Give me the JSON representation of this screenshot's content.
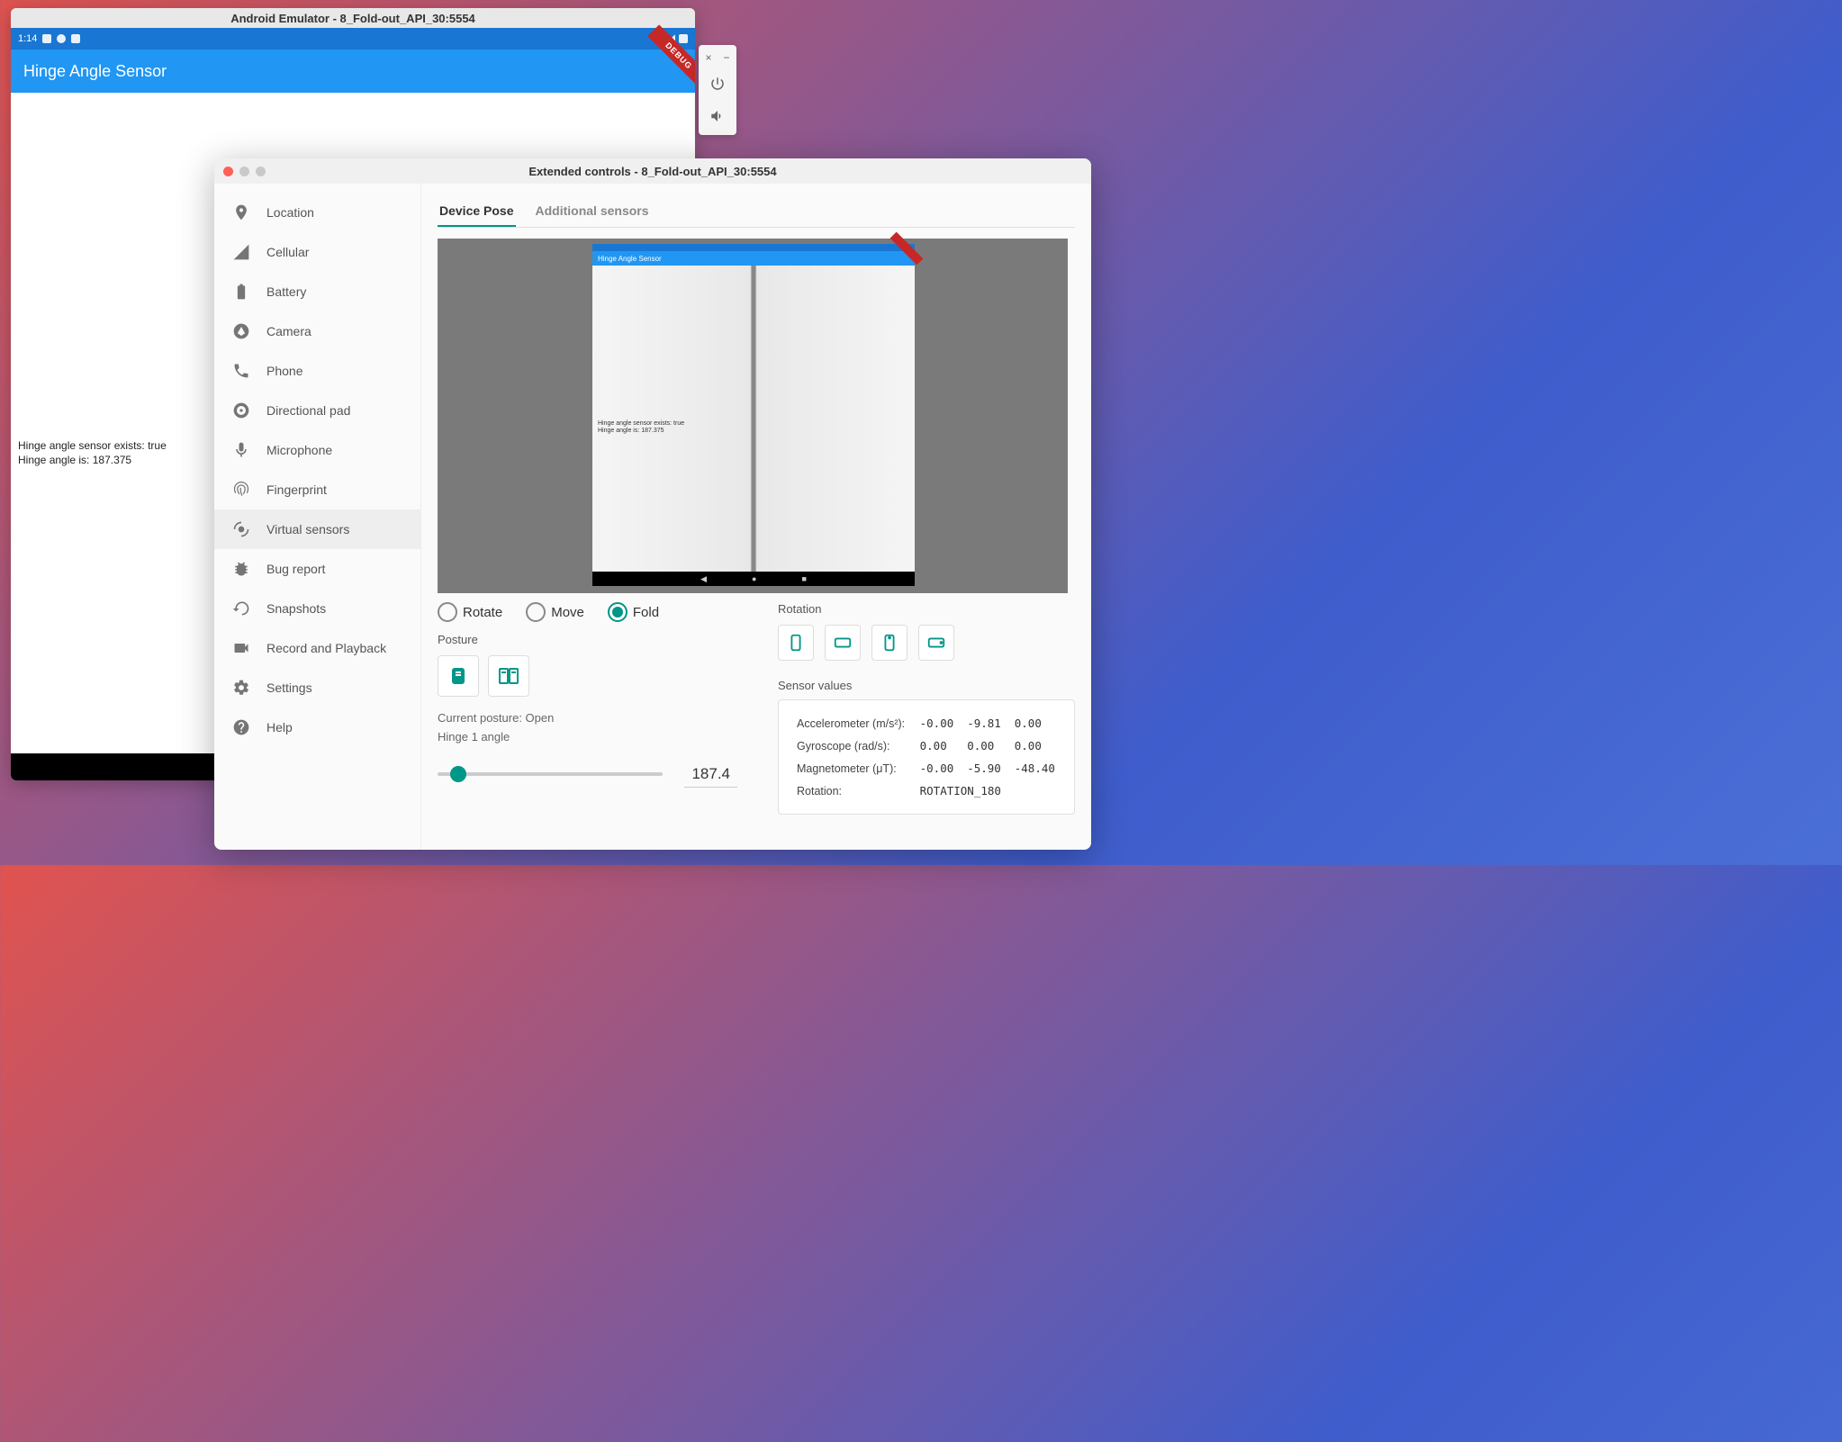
{
  "emulator": {
    "title": "Android Emulator - 8_Fold-out_API_30:5554",
    "statusbar": {
      "time": "1:14"
    },
    "debug_ribbon": "DEBUG",
    "app": {
      "title": "Hinge Angle Sensor",
      "body_line1": "Hinge angle sensor exists: true",
      "body_line2": "Hinge angle is: 187.375"
    }
  },
  "side_toolbar": {
    "close": "×",
    "minimize": "−"
  },
  "extended": {
    "title": "Extended controls - 8_Fold-out_API_30:5554",
    "sidebar": {
      "items": [
        {
          "label": "Location",
          "icon": "location"
        },
        {
          "label": "Cellular",
          "icon": "cellular"
        },
        {
          "label": "Battery",
          "icon": "battery"
        },
        {
          "label": "Camera",
          "icon": "camera"
        },
        {
          "label": "Phone",
          "icon": "phone"
        },
        {
          "label": "Directional pad",
          "icon": "dpad"
        },
        {
          "label": "Microphone",
          "icon": "mic"
        },
        {
          "label": "Fingerprint",
          "icon": "fingerprint"
        },
        {
          "label": "Virtual sensors",
          "icon": "sensors"
        },
        {
          "label": "Bug report",
          "icon": "bug"
        },
        {
          "label": "Snapshots",
          "icon": "snapshot"
        },
        {
          "label": "Record and Playback",
          "icon": "record"
        },
        {
          "label": "Settings",
          "icon": "settings"
        },
        {
          "label": "Help",
          "icon": "help"
        }
      ],
      "active_index": 8
    },
    "tabs": [
      {
        "label": "Device Pose",
        "active": true
      },
      {
        "label": "Additional sensors",
        "active": false
      }
    ],
    "preview": {
      "appbar": "Hinge Angle Sensor",
      "body_line1": "Hinge angle sensor exists: true",
      "body_line2": "Hinge angle is: 187.375"
    },
    "pose_radios": [
      {
        "label": "Rotate",
        "selected": false
      },
      {
        "label": "Move",
        "selected": false
      },
      {
        "label": "Fold",
        "selected": true
      }
    ],
    "posture": {
      "label": "Posture",
      "current": "Current posture: Open",
      "hinge_label": "Hinge 1 angle",
      "value": "187.4"
    },
    "rotation": {
      "label": "Rotation"
    },
    "sensor_values": {
      "title": "Sensor values",
      "rows": [
        {
          "name": "Accelerometer (m/s²):",
          "v": [
            "-0.00",
            "-9.81",
            "0.00"
          ]
        },
        {
          "name": "Gyroscope (rad/s):",
          "v": [
            "0.00",
            "0.00",
            "0.00"
          ]
        },
        {
          "name": "Magnetometer (μT):",
          "v": [
            "-0.00",
            "-5.90",
            "-48.40"
          ]
        },
        {
          "name": "Rotation:",
          "v": [
            "ROTATION_180",
            "",
            ""
          ]
        }
      ]
    }
  }
}
